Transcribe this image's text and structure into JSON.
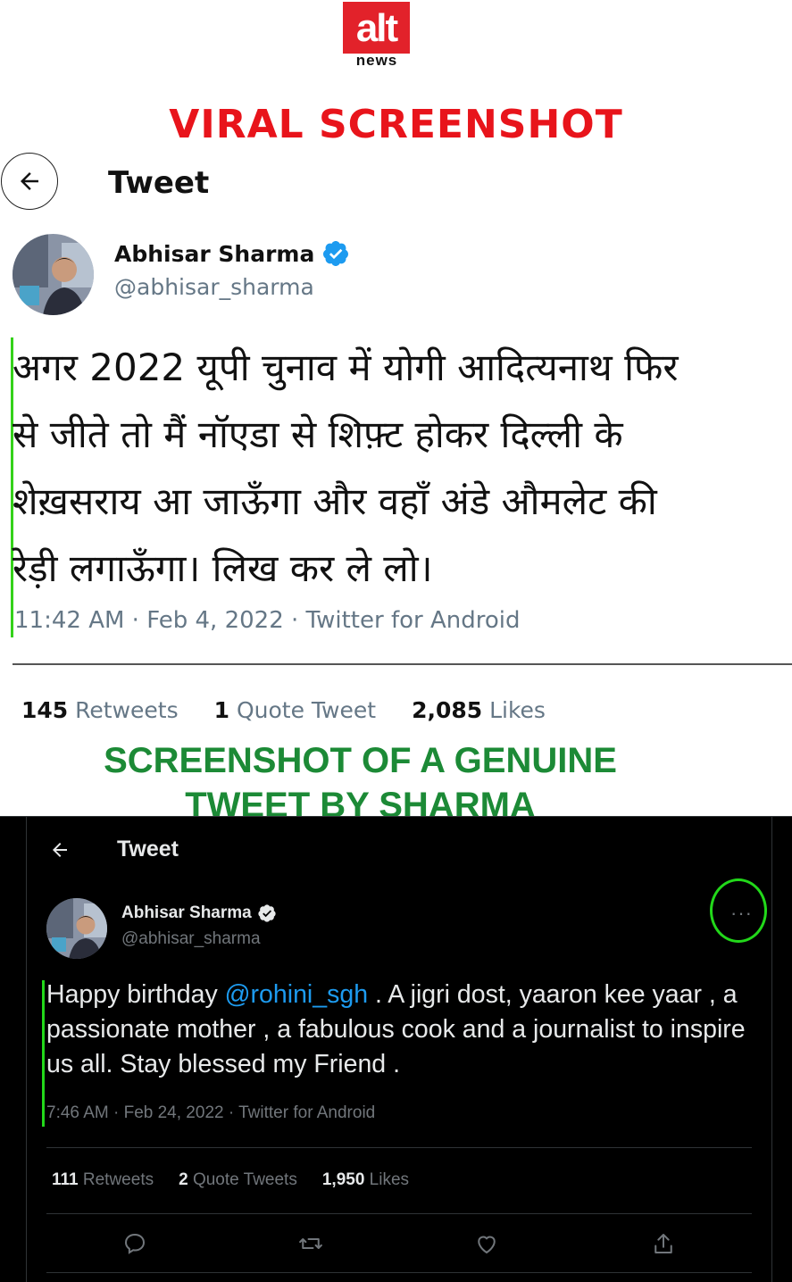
{
  "logo": {
    "alt": "alt",
    "news": "news"
  },
  "labels": {
    "viral": "VIRAL SCREENSHOT",
    "genuine_line1": "SCREENSHOT OF A GENUINE",
    "genuine_line2": "TWEET BY SHARMA"
  },
  "viral_tweet": {
    "header_title": "Tweet",
    "name": "Abhisar Sharma",
    "handle": "@abhisar_sharma",
    "text_lines": [
      "अगर 2022 यूपी चुनाव में योगी आदित्यनाथ फिर",
      "से जीते तो मैं नॉएडा से शिफ़्ट होकर दिल्ली के",
      "शेख़सराय आ जाऊँगा और वहाँ अंडे औमलेट की",
      "रेड़ी लगाऊँगा। लिख कर ले लो।"
    ],
    "meta": "11:42 AM · Feb 4, 2022 · Twitter for Android",
    "stats": {
      "retweets_count": "145",
      "retweets_label": "Retweets",
      "quotes_count": "1",
      "quotes_label": "Quote Tweet",
      "likes_count": "2,085",
      "likes_label": "Likes"
    }
  },
  "genuine_tweet": {
    "header_title": "Tweet",
    "name": "Abhisar Sharma",
    "handle": "@abhisar_sharma",
    "more": "···",
    "text_before": "Happy birthday ",
    "mention": "@rohini_sgh",
    "text_after": " . A jigri dost, yaaron kee yaar , a passionate mother , a fabulous cook and a journalist to inspire us all. Stay blessed my Friend .",
    "meta": "7:46 AM · Feb 24, 2022 · Twitter for Android",
    "stats": {
      "retweets_count": "111",
      "retweets_label": "Retweets",
      "quotes_count": "2",
      "quotes_label": "Quote Tweets",
      "likes_count": "1,950",
      "likes_label": "Likes"
    }
  },
  "colors": {
    "alt_red": "#e2222a",
    "viral_red": "#e8141b",
    "genuine_green": "#1c8a36",
    "highlight_green": "#22d81a",
    "verified_blue": "#1d9bf0",
    "dark_bg": "#000000"
  },
  "icons": [
    "back-arrow-icon",
    "verified-badge-icon",
    "more-icon",
    "reply-icon",
    "retweet-icon",
    "like-icon",
    "share-icon"
  ]
}
